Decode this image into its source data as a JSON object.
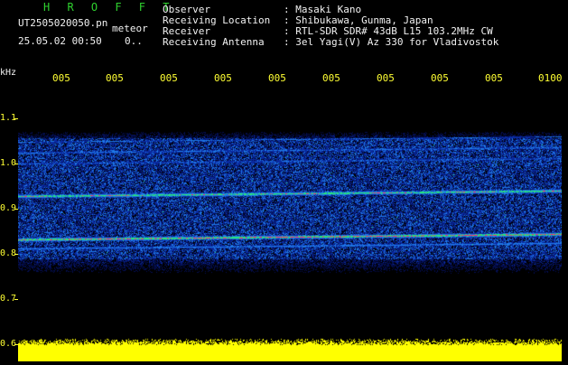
{
  "header": {
    "app_title": "H R O F F T",
    "file_name": "UT2505020050.pn",
    "mode": "meteor",
    "timestamp": "25.05.02 00:50",
    "count": "0.."
  },
  "info": [
    {
      "key": "Observer",
      "value": ": Masaki Kano"
    },
    {
      "key": "Receiving Location",
      "value": ": Shibukawa, Gunma, Japan"
    },
    {
      "key": "Receiver",
      "value": ": RTL-SDR SDR# 43dB L15 103.2MHz CW"
    },
    {
      "key": "Receiving Antenna",
      "value": ": 3el Yagi(V) Az 330 for Vladivostok"
    }
  ],
  "axes": {
    "y_unit": "kHz",
    "y_ticks": [
      "1.1",
      "1.0",
      "0.9",
      "0.8",
      "0.7",
      "0.6"
    ],
    "y_range": [
      0.6,
      1.1
    ],
    "x_ticks": [
      "005",
      "005",
      "005",
      "005",
      "005",
      "005",
      "005",
      "005",
      "005",
      "0100"
    ]
  },
  "colors": {
    "background": "#000000",
    "axis_labels": "#ffff33",
    "text": "#f2f2f2",
    "title": "#2fd12f",
    "noise_low": "#0a2aa0",
    "noise_mid": "#1e78e6",
    "signal": "#ff3060",
    "amplitude_trace": "#ffff00"
  }
}
